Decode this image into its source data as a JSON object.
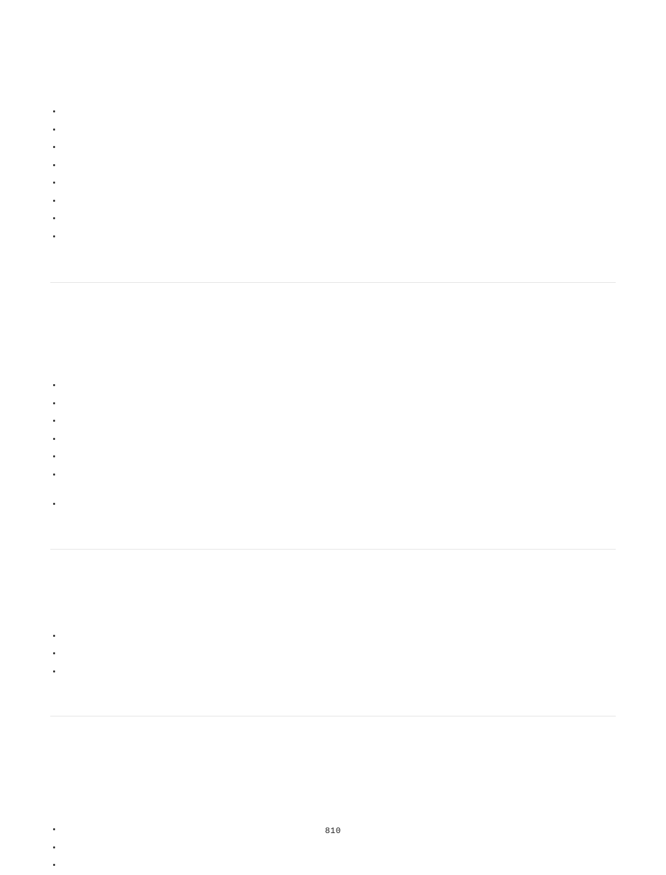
{
  "page_number": "810",
  "sections": [
    {
      "bullets": [
        "",
        "",
        "",
        "",
        "",
        "",
        "",
        ""
      ]
    },
    {
      "bullets": [
        "",
        "",
        "",
        "",
        "",
        "",
        ""
      ],
      "gap_before_last": true
    },
    {
      "bullets": [
        "",
        "",
        ""
      ]
    },
    {
      "bullets": [
        "",
        "",
        ""
      ]
    }
  ]
}
